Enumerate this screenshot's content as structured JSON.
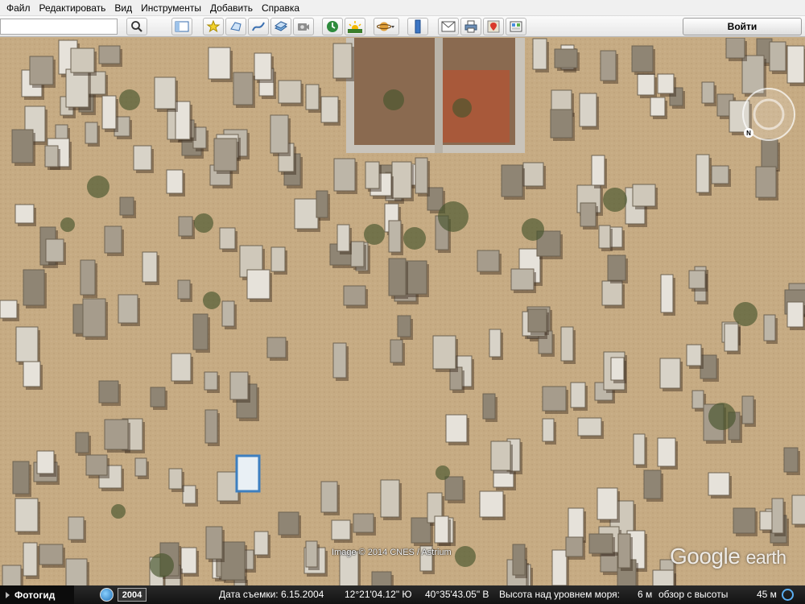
{
  "menu": {
    "items": [
      {
        "label": "Файл"
      },
      {
        "label": "Редактировать"
      },
      {
        "label": "Вид"
      },
      {
        "label": "Инструменты"
      },
      {
        "label": "Добавить"
      },
      {
        "label": "Справка"
      }
    ]
  },
  "toolbar": {
    "search_value": "",
    "login_label": "Войти",
    "icons": [
      "search-icon",
      "sidebar-toggle-icon",
      "placemark-icon",
      "polygon-icon",
      "path-icon",
      "image-overlay-icon",
      "tour-icon",
      "historical-imagery-icon",
      "sunlight-icon",
      "planet-icon",
      "ruler-icon",
      "email-icon",
      "print-icon",
      "google-maps-icon",
      "kml-gallery-icon"
    ]
  },
  "map": {
    "copyright": "Image © 2014 CNES / Astrium",
    "logo_google": "Google",
    "logo_earth": "earth",
    "navigation_label": "N"
  },
  "status": {
    "title": "Фотогид",
    "year": "2004",
    "image_date": "Дата съемки: 6.15.2004",
    "latitude": "12°21'04.12\" Ю",
    "longitude": "40°35'43.05\" В",
    "elevation": "Высота над уровнем моря:",
    "elevation_value": "6 м",
    "eye_alt_label": "обзор с высоты",
    "eye_alt_value": "45 м"
  }
}
